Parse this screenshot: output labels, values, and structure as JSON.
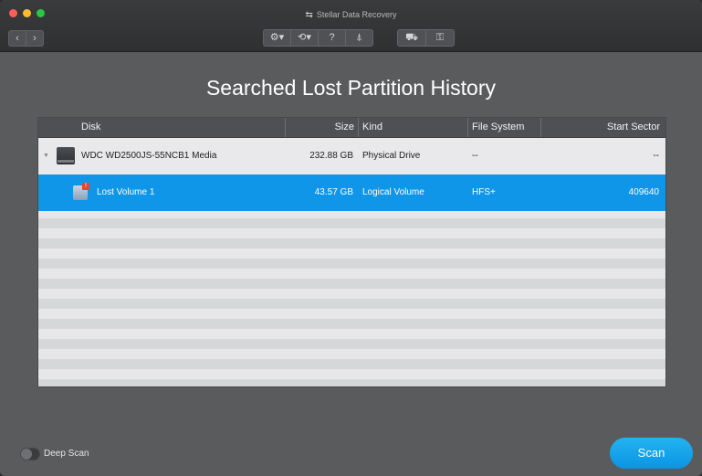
{
  "window": {
    "title": "Stellar Data Recovery"
  },
  "nav": {
    "back_icon": "chevron-left-icon",
    "forward_icon": "chevron-right-icon"
  },
  "toolbar": {
    "settings_icon": "gear-icon",
    "history_icon": "history-icon",
    "help_label": "?",
    "monitor_icon": "drive-monitor-icon",
    "cart_icon": "cart-icon",
    "key_icon": "key-icon"
  },
  "heading": "Searched Lost Partition History",
  "table": {
    "columns": [
      "Disk",
      "Size",
      "Kind",
      "File System",
      "Start Sector"
    ],
    "rows": [
      {
        "name": "WDC WD2500JS-55NCB1 Media",
        "size": "232.88 GB",
        "kind": "Physical Drive",
        "fs": "--",
        "start": "--"
      },
      {
        "name": "Lost Volume 1",
        "size": "43.57 GB",
        "kind": "Logical Volume",
        "fs": "HFS+",
        "start": "409640"
      }
    ]
  },
  "footer": {
    "deep_scan_label": "Deep Scan",
    "deep_scan_on": false,
    "scan_label": "Scan"
  },
  "colors": {
    "accent": "#0f96e8",
    "background": "#5a5b5d"
  }
}
